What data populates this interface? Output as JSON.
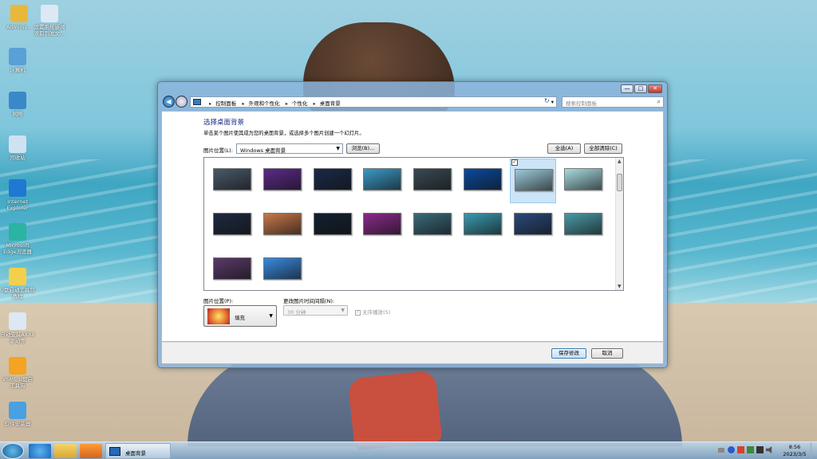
{
  "desktop": {
    "icons": [
      {
        "label": "Adminis...",
        "color": "#e8b83a"
      },
      {
        "label": "设置系统新闻 读取到发文...",
        "color": "#dde8f4"
      },
      {
        "label": "计算机",
        "color": "#5aa0d8"
      },
      {
        "label": "网络",
        "color": "#3a88c8"
      },
      {
        "label": "回收站",
        "color": "#cfe2f2"
      },
      {
        "label": "Internet Explorer",
        "color": "#1f78d1"
      },
      {
        "label": "Microsoft Edge浏览器",
        "color": "#2bb3a4"
      },
      {
        "label": "U盘启动工具包 教程",
        "color": "#f2d04b"
      },
      {
        "label": "自动安装AX88 驱动等",
        "color": "#dde8f4"
      },
      {
        "label": "VSME U盘启 工具箱",
        "color": "#f4a322"
      },
      {
        "label": "软件安装器",
        "color": "#4aa0e0"
      }
    ]
  },
  "taskbar": {
    "window_label": "桌面背景",
    "time": "8:56",
    "date": "2023/3/5"
  },
  "window": {
    "caption_buttons": [
      "—",
      "□",
      "✕"
    ],
    "address": {
      "segments": [
        "控制面板",
        "外观和个性化",
        "个性化",
        "桌面背景"
      ]
    },
    "search_placeholder": "搜索控制面板",
    "title": "选择桌面背景",
    "description": "单击某个图片使其成为您的桌面背景，或选择多个图片创建一个幻灯片。",
    "picture_location_label": "图片位置(L):",
    "picture_location_value": "Windows 桌面背景",
    "browse_button": "浏览(B)...",
    "select_all_button": "全选(A)",
    "clear_all_button": "全部清除(C)",
    "thumbnails_row1": [
      "#4a5a6a",
      "#5d2a8a",
      "#1a2a4a",
      "#3a9ac8",
      "#3a4a55",
      "#0a4aa0",
      "#9ccad8",
      "#a8dce0"
    ],
    "thumbnails_row2": [
      "#1e2a40",
      "#c8784a",
      "#122030",
      "#8a2a8a",
      "#3a6a7a",
      "#3a9ab0",
      "#2a4a7a",
      "#4a9aa8"
    ],
    "thumbnails_row3": [
      "#5a3a6a",
      "#3a8ae0"
    ],
    "selected_index": 6,
    "position_label": "图片位置(P):",
    "position_value": "填充",
    "interval_label": "更改图片时间间隔(N):",
    "interval_value": "30 分钟",
    "shuffle_label": "无序播放(S)",
    "save_button": "保存修改",
    "cancel_button": "取消"
  }
}
